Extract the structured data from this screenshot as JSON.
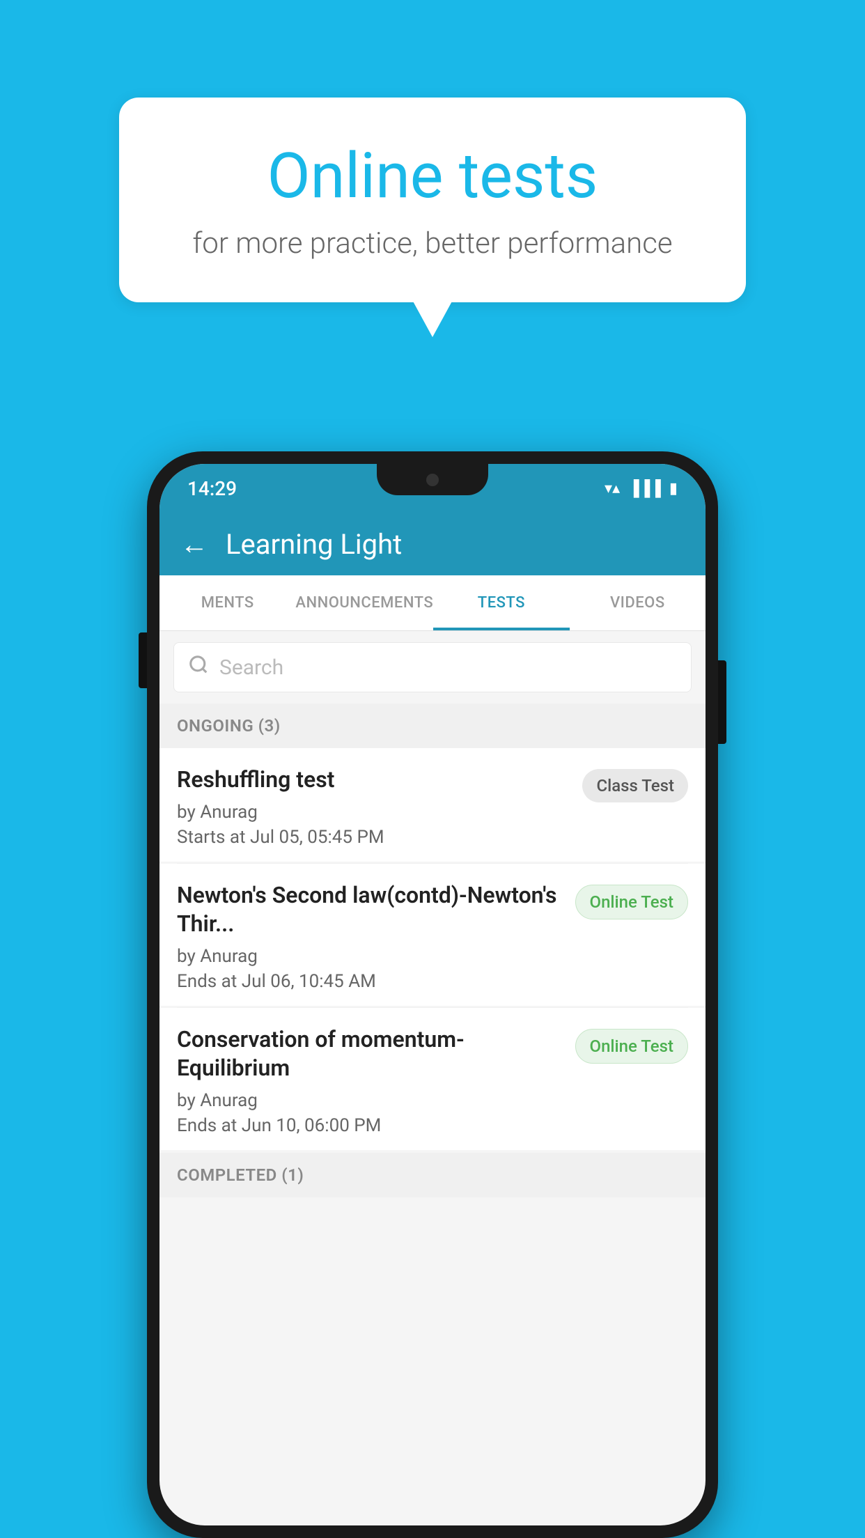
{
  "background": {
    "color": "#1ab8e8"
  },
  "speech_bubble": {
    "title": "Online tests",
    "subtitle": "for more practice, better performance"
  },
  "phone": {
    "status_bar": {
      "time": "14:29",
      "wifi": "▼",
      "signal": "▲",
      "battery": "▮"
    },
    "header": {
      "back_label": "←",
      "title": "Learning Light"
    },
    "tabs": [
      {
        "label": "MENTS",
        "active": false
      },
      {
        "label": "ANNOUNCEMENTS",
        "active": false
      },
      {
        "label": "TESTS",
        "active": true
      },
      {
        "label": "VIDEOS",
        "active": false
      }
    ],
    "search": {
      "placeholder": "Search"
    },
    "sections": [
      {
        "header": "ONGOING (3)",
        "items": [
          {
            "name": "Reshuffling test",
            "author": "by Anurag",
            "time_label": "Starts at",
            "time": "Jul 05, 05:45 PM",
            "badge": "Class Test",
            "badge_type": "class"
          },
          {
            "name": "Newton's Second law(contd)-Newton's Thir...",
            "author": "by Anurag",
            "time_label": "Ends at",
            "time": "Jul 06, 10:45 AM",
            "badge": "Online Test",
            "badge_type": "online"
          },
          {
            "name": "Conservation of momentum-Equilibrium",
            "author": "by Anurag",
            "time_label": "Ends at",
            "time": "Jun 10, 06:00 PM",
            "badge": "Online Test",
            "badge_type": "online"
          }
        ]
      },
      {
        "header": "COMPLETED (1)",
        "items": []
      }
    ]
  }
}
